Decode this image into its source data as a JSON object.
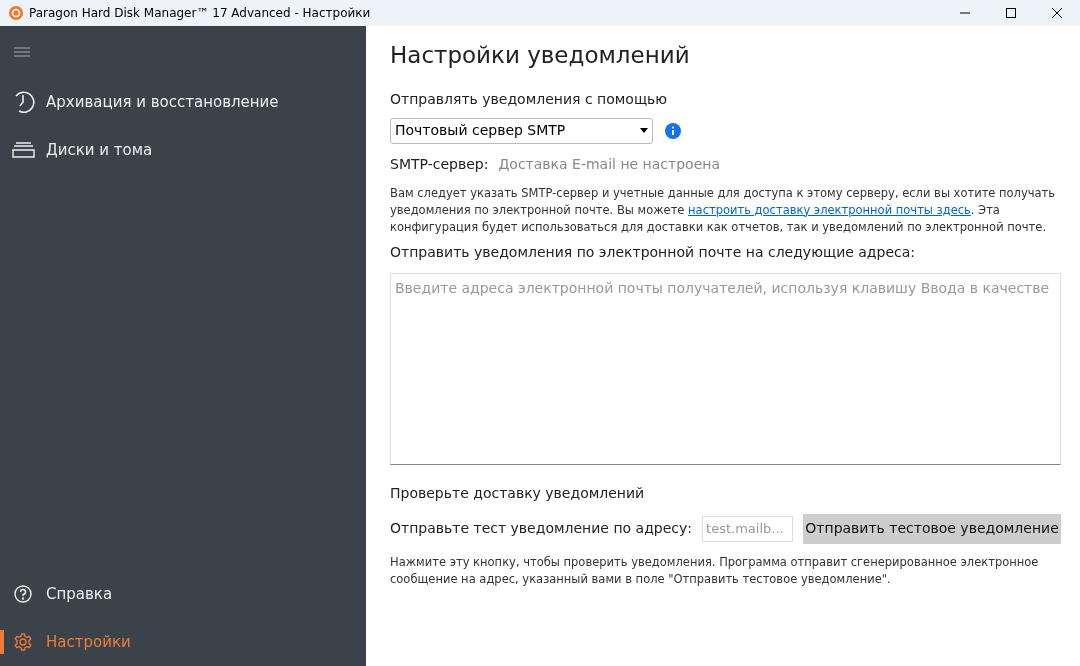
{
  "window": {
    "title": "Paragon Hard Disk Manager™ 17 Advanced - Настройки"
  },
  "sidebar": {
    "items": [
      {
        "kind": "clock",
        "label": "Архивация и восстановление",
        "selected": false
      },
      {
        "kind": "disks",
        "label": "Диски и тома",
        "selected": false
      }
    ],
    "bottom_items": [
      {
        "kind": "help",
        "label": "Справка",
        "selected": false
      },
      {
        "kind": "gear",
        "label": "Настройки",
        "selected": true
      }
    ]
  },
  "page": {
    "title": "Настройки уведомлений",
    "send_via_label": "Отправлять уведомления с помощью",
    "send_via_value": "Почтовый сервер SMTP",
    "smtp_label": "SMTP-сервер:",
    "smtp_value": "Доставка E-mail не настроена",
    "description": {
      "before": "Вам следует указать SMTP-сервер и учетные данные для доступа к этому серверу, если вы хотите получать уведомления по электронной почте. Вы можете ",
      "link": "настроить доставку электронной почты здесь",
      "after": ". Эта конфигурация будет использоваться для доставки как отчетов, так и уведомлений по электронной почте."
    },
    "recipients_label": "Отправить уведомления по электронной почте на следующие адреса:",
    "recipients_placeholder": "Введите адреса электронной почты получателей, используя клавишу Ввода в качестве",
    "test_heading": "Проверьте доставку уведомлений",
    "test_label": "Отправьте тест уведомление по адресу:",
    "test_placeholder": "test.mailb...",
    "test_button": "Отправить тестовое уведомление",
    "test_hint": "Нажмите эту кнопку, чтобы проверить уведомления. Программа отправит сгенерированное электронное сообщение на адрес, указанный вами в поле \"Отправить тестовое уведомление\"."
  }
}
